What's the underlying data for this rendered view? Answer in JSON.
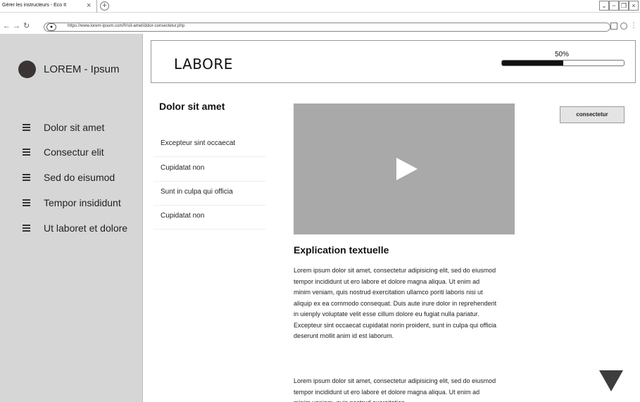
{
  "browser": {
    "tab_title": "Gérer les instructeurs - Eco It",
    "tab_close": "×",
    "new_tab": "+",
    "url": "https://www.lorem-ipsum.com/fr/sit-amet/dolor-consectetur.php",
    "nav_back": "←",
    "nav_forward": "→",
    "nav_reload": "↻",
    "lock_icon": "🔒",
    "window_controls": [
      "⌄",
      "−",
      "❐",
      "×"
    ],
    "menu_dots": "⋮"
  },
  "sidebar": {
    "brand": "LOREM - Ipsum",
    "items": [
      {
        "label": "Dolor sit amet"
      },
      {
        "label": "Consectur elit"
      },
      {
        "label": "Sed do eisumod"
      },
      {
        "label": "Tempor insididunt"
      },
      {
        "label": "Ut laboret et dolore"
      }
    ]
  },
  "header": {
    "title": "LABORE",
    "progress_label": "50%",
    "progress_value": 0.5
  },
  "lessons": {
    "title": "Dolor sit amet",
    "items": [
      {
        "label": "Excepteur sint occaecat"
      },
      {
        "label": "Cupidatat non"
      },
      {
        "label": "Sunt in culpa qui officia"
      },
      {
        "label": "Cupidatat non"
      }
    ]
  },
  "video": {
    "icon": "play-icon"
  },
  "side_button": {
    "label": "consectetur"
  },
  "content": {
    "title": "Explication textuelle",
    "paragraph_1": "Lorem ipsum dolor sit amet, consectetur adipisicing elit, sed do eiusmod tempor incididunt ut ero labore et dolore magna aliqua. Ut enim ad minim veniam, quis nostrud exercitation ullamco poriti laboris nisi ut aliquip ex ea commodo consequat. Duis aute irure dolor in reprehenderit in uienply voluptate velit esse cillum dolore eu fugiat nulla pariatur. Excepteur sint occaecat cupidatat norin proident, sunt in culpa qui officia deserunt mollit anim id est laborum.",
    "paragraph_2": "Lorem ipsum dolor sit amet, consectetur adipisicing elit, sed do eiusmod tempor incididunt ut ero labore et dolore magna aliqua. Ut enim ad minim veniam, quis nostrud exercitation"
  },
  "colors": {
    "sidebar_bg": "#d6d6d6",
    "video_bg": "#a9a9a9",
    "progress_fill": "#111111",
    "avatar": "#3a3434"
  }
}
